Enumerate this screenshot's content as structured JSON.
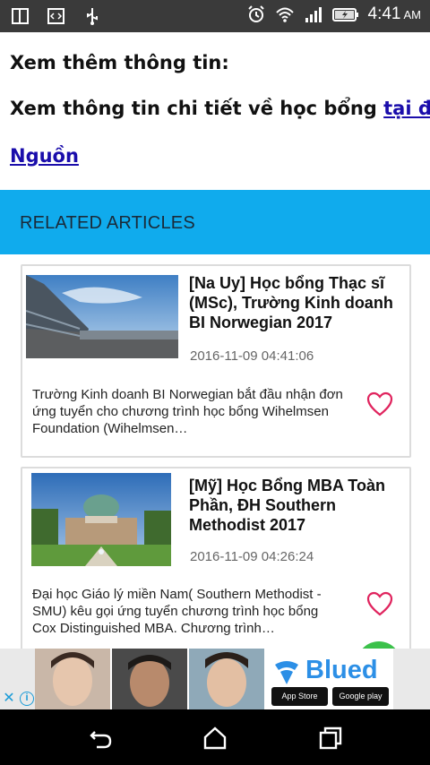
{
  "status_bar": {
    "time": "4:41",
    "ampm": "AM",
    "icons": [
      "window-icon",
      "code-icon",
      "usb-icon",
      "alarm-icon",
      "wifi-icon",
      "signal-icon",
      "battery-charging-icon"
    ]
  },
  "article": {
    "more_title": "Xem thêm thông tin:",
    "more_line_prefix": "Xem thông tin chi tiết về học bổng ",
    "more_line_link": "tại đây",
    "more_line_suffix": ".",
    "source_link": "Nguồn"
  },
  "related": {
    "header": "RELATED ARTICLES",
    "items": [
      {
        "title": "[Na Uy] Học bổng Thạc sĩ (MSc), Trường Kinh doanh BI Norwegian 2017",
        "date": "2016-11-09 04:41:06",
        "description": "Trường Kinh doanh BI Norwegian bắt đầu nhận đơn ứng tuyển cho chương trình học bổng Wihelmsen Foundation (Wihelmsen…"
      },
      {
        "title": "[Mỹ] Học Bổng MBA Toàn Phần, ĐH Southern Methodist 2017",
        "date": "2016-11-09 04:26:24",
        "description": "Đại học Giáo lý miền Nam( Southern Methodist - SMU) kêu gọi ứng tuyển chương trình học bổng Cox Distinguished MBA. Chương trình…"
      }
    ]
  },
  "ad": {
    "brand": "Blued",
    "badge_appstore": "App Store",
    "badge_gplay": "Google play"
  },
  "colors": {
    "accent": "#10abed",
    "link": "#1a0dab",
    "heart": "#e0245e",
    "statusbar": "#3a3a3a"
  }
}
